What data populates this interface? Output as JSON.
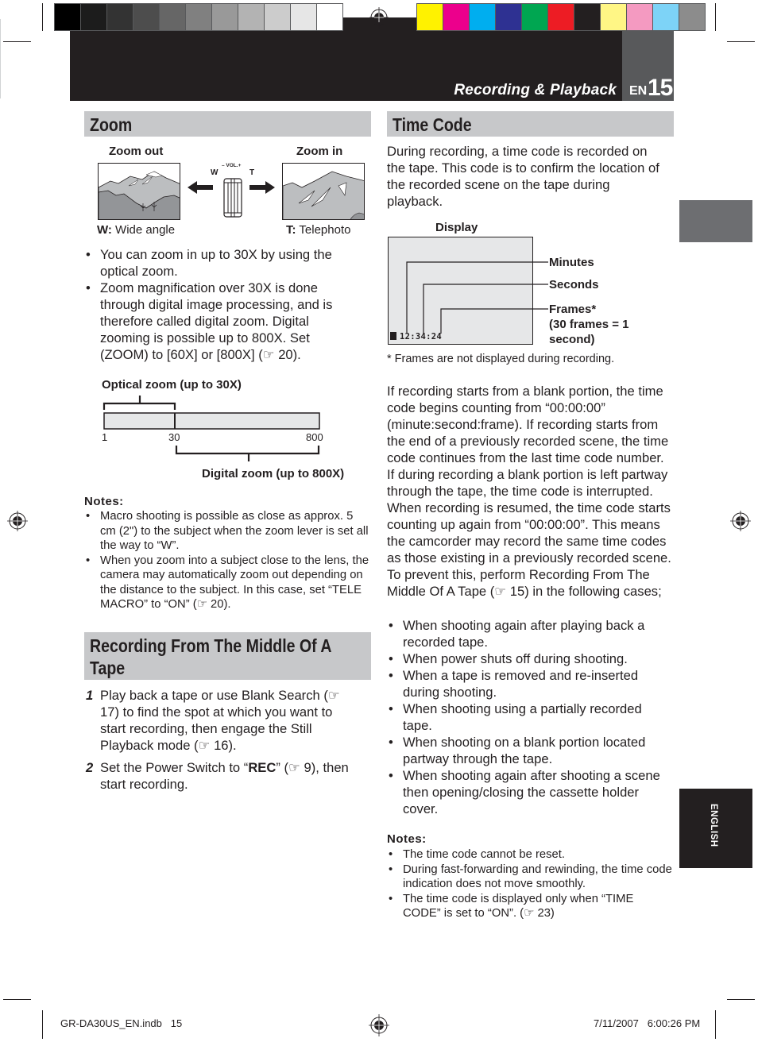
{
  "print_marks": {
    "grayscale_swatches": [
      "#000000",
      "#1c1c1c",
      "#333333",
      "#4d4d4d",
      "#666666",
      "#808080",
      "#999999",
      "#b3b3b3",
      "#cccccc",
      "#e6e6e6",
      "#ffffff"
    ],
    "color_swatches": [
      "#fff200",
      "#ec008c",
      "#00aeef",
      "#2e3192",
      "#00a651",
      "#ed1c24",
      "#231f20",
      "#fff685",
      "#f49ac1",
      "#7dd3f7",
      "#8c8c8c"
    ],
    "registration_mark": "crosshair-target"
  },
  "header": {
    "section_title": "Recording & Playback",
    "lang": "EN",
    "page_number": "15"
  },
  "zoom": {
    "title": "Zoom",
    "illustration": {
      "zoom_out_label": "Zoom out",
      "zoom_in_label": "Zoom in",
      "lever_w": "W",
      "lever_t": "T",
      "lever_vol": "– VOL.+",
      "w_caption_bold": "W:",
      "w_caption": " Wide angle",
      "t_caption_bold": "T:",
      "t_caption": " Telephoto"
    },
    "bullets": [
      "You can zoom in up to 30X by using the optical zoom.",
      "Zoom magnification over 30X is done through digital image processing, and is therefore called digital zoom. Digital zooming is possible up to 800X. Set (ZOOM) to [60X] or [800X] (☞ 20)."
    ],
    "range_diagram": {
      "optical_label": "Optical zoom (up to 30X)",
      "digital_label": "Digital zoom (up to 800X)",
      "ticks": [
        "1",
        "30",
        "800"
      ],
      "optical_max": 30,
      "digital_max": 800
    },
    "notes_label": "Notes:",
    "notes": [
      "Macro shooting is possible as close as approx. 5 cm (2\") to the subject when the zoom lever is set all the way to “W”.",
      "When you zoom into a subject close to the lens, the camera may automatically zoom out depending on the distance to the subject. In this case, set “TELE MACRO” to “ON” (☞ 20)."
    ]
  },
  "recording_middle": {
    "title": "Recording From The Middle Of A Tape",
    "steps": [
      {
        "num": "1",
        "text": "Play back a tape or use Blank Search (☞ 17) to find the spot at which you want to start recording, then engage the Still Playback mode (☞ 16)."
      },
      {
        "num": "2",
        "pre": "Set the Power Switch to “",
        "bold": "REC",
        "post": "” (☞ 9), then start recording."
      }
    ]
  },
  "time_code": {
    "title": "Time Code",
    "intro": "During recording, a time code is recorded on the tape. This code is to confirm the location of the recorded scene on the tape during playback.",
    "display": {
      "label": "Display",
      "timecode": "12:34:24",
      "minutes_label": "Minutes",
      "seconds_label": "Seconds",
      "frames_label": "Frames*",
      "frames_note": "(30 frames = 1 second)",
      "footnote": "* Frames are not displayed during recording."
    },
    "body": "If recording starts from a blank portion, the time code begins counting from “00:00:00” (minute:second:frame). If recording starts from the end of a previously recorded scene, the time code continues from the last time code number. If during recording a blank portion is left partway through the tape, the time code is interrupted. When recording is resumed, the time code starts counting up again from “00:00:00”. This means the camcorder may record the same time codes as those existing in a previously recorded scene. To prevent this, perform Recording From The Middle Of A Tape (☞ 15) in the following cases;",
    "cases": [
      "When shooting again after playing back a recorded tape.",
      "When power shuts off during shooting.",
      "When a tape is removed and re-inserted during shooting.",
      "When shooting using a partially recorded tape.",
      "When shooting on a blank portion located partway through the tape.",
      "When shooting again after shooting a scene then opening/closing the cassette holder cover."
    ],
    "notes_label": "Notes:",
    "notes": [
      "The time code cannot be reset.",
      "During fast-forwarding and rewinding, the time code indication does not move smoothly.",
      "The time code is displayed only when “TIME CODE” is set to “ON”. (☞ 23)"
    ]
  },
  "side_tab": {
    "language": "ENGLISH"
  },
  "footer": {
    "file": "GR-DA30US_EN.indb   15",
    "timestamp": "7/11/2007   6:00:26 PM"
  }
}
